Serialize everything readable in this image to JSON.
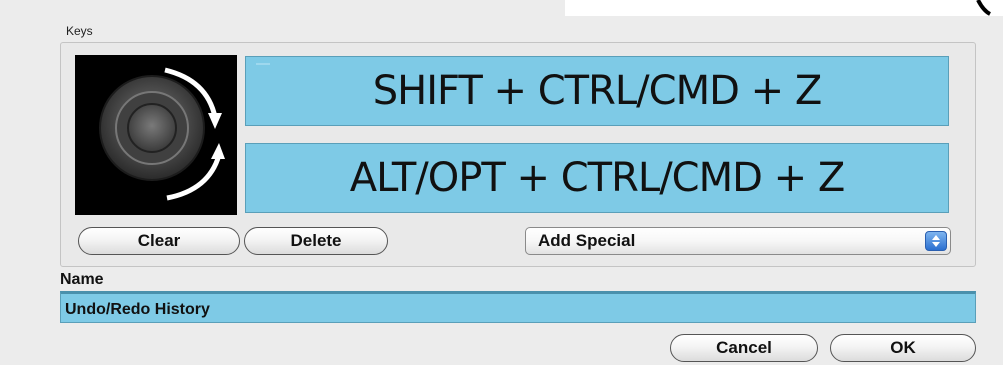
{
  "keys_group": {
    "label": "Keys",
    "mappings": [
      {
        "label": "SHIFT + CTRL/CMD + Z",
        "direction": "clockwise"
      },
      {
        "label": "ALT/OPT + CTRL/CMD + Z",
        "direction": "counterclockwise"
      }
    ],
    "controller_icon": "jog-wheel-icon"
  },
  "buttons": {
    "clear": "Clear",
    "delete": "Delete",
    "cancel": "Cancel",
    "ok": "OK"
  },
  "add_special": {
    "selected": "Add Special",
    "icon": "select-arrows-icon"
  },
  "name": {
    "label": "Name",
    "value": "Undo/Redo History"
  },
  "colors": {
    "field_bg": "#7ecae6",
    "dialog_bg": "#ececec",
    "accent_blue": "#2b6fd0"
  }
}
